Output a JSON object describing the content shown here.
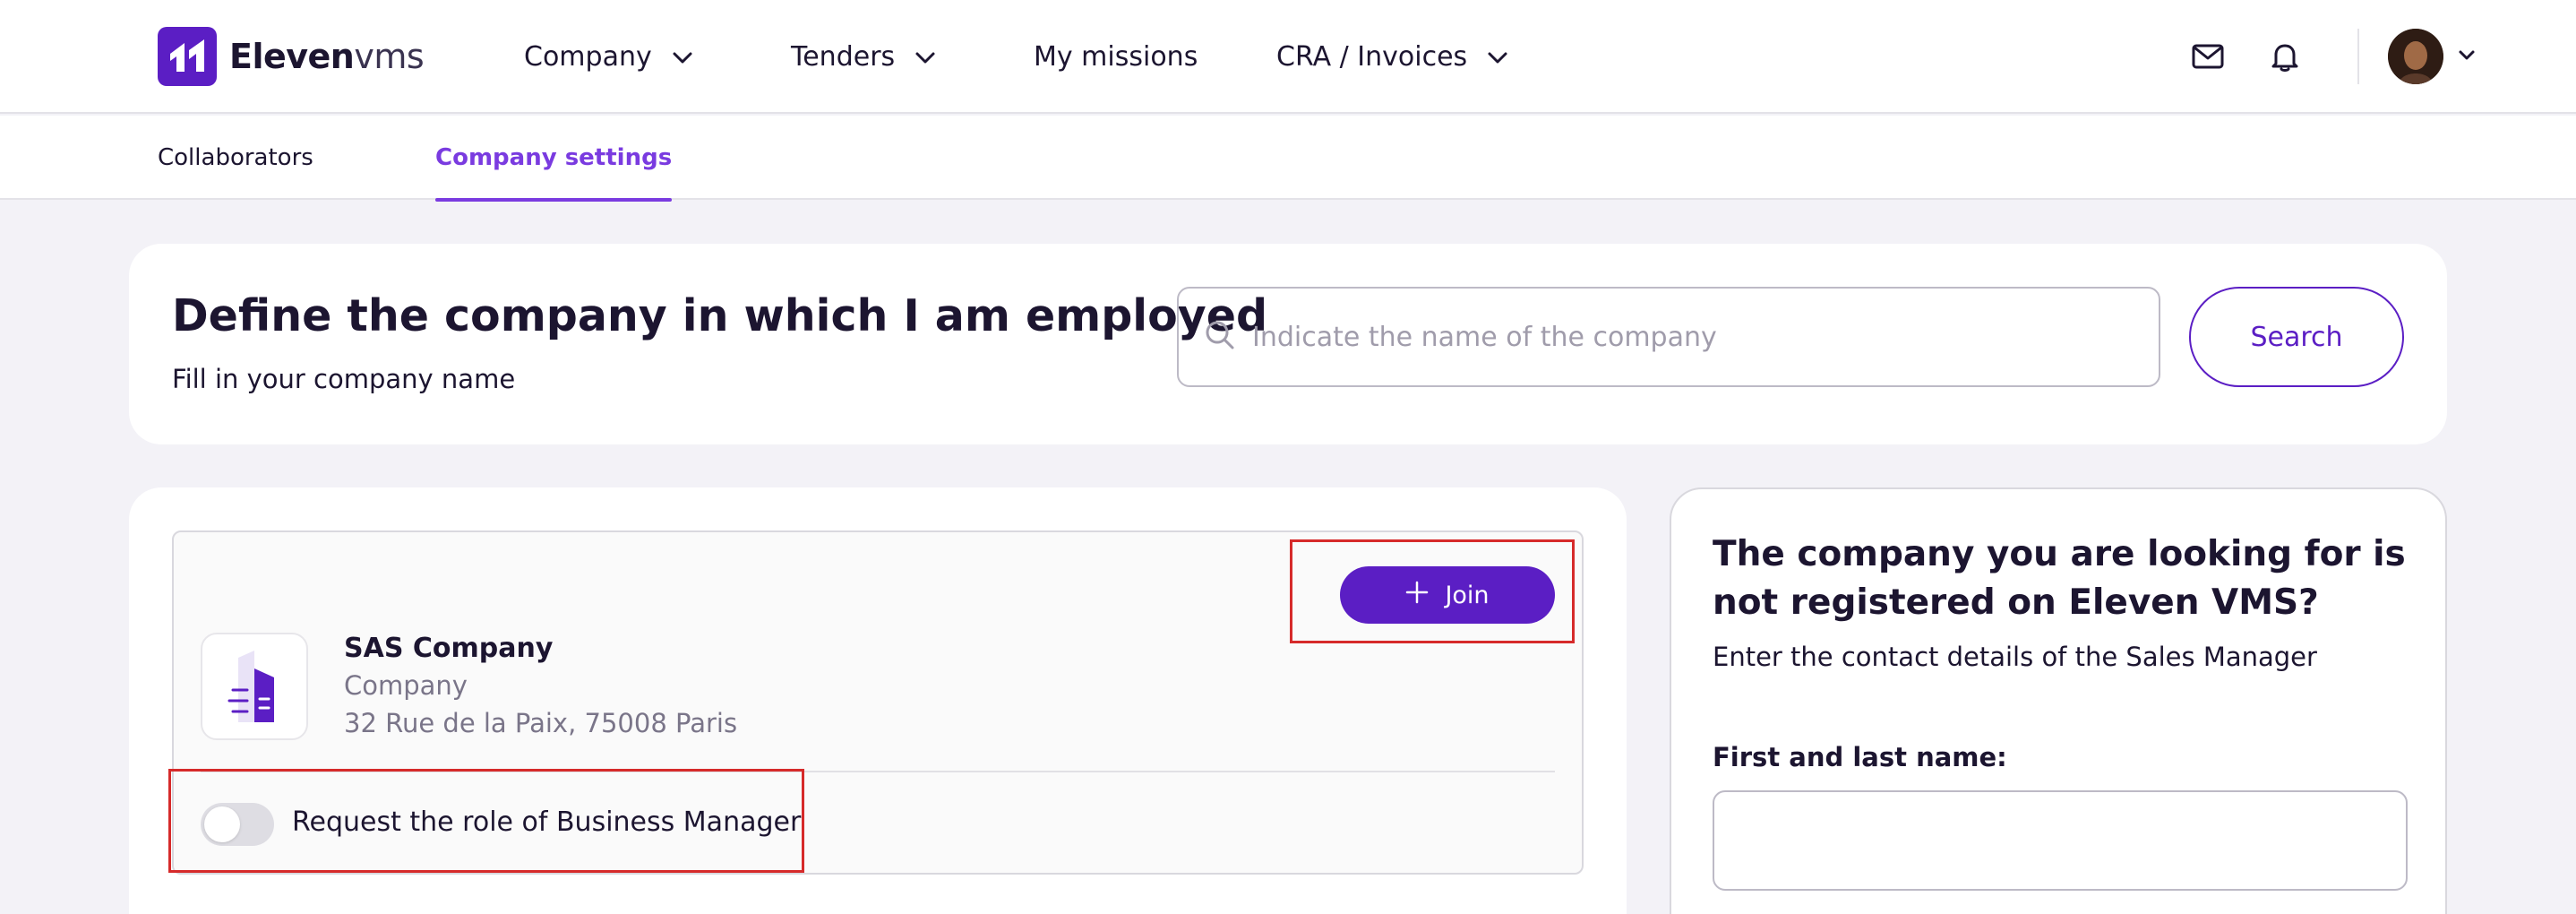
{
  "header": {
    "logo": {
      "bold": "Eleven",
      "light": "vms"
    },
    "nav": [
      {
        "label": "Company",
        "dropdown": true
      },
      {
        "label": "Tenders",
        "dropdown": true
      },
      {
        "label": "My missions",
        "dropdown": false
      },
      {
        "label": "CRA / Invoices",
        "dropdown": true
      }
    ],
    "icons": [
      "mail-icon",
      "bell-icon",
      "avatar",
      "chevron-down-icon"
    ]
  },
  "subnav": {
    "tabs": [
      {
        "label": "Collaborators",
        "active": false
      },
      {
        "label": "Company settings",
        "active": true
      }
    ]
  },
  "define_company": {
    "title": "Define the company in which I am employed",
    "subtitle": "Fill in your company name",
    "search_placeholder": "Indicate the name of the company",
    "search_value": "",
    "search_button": "Search"
  },
  "result": {
    "join_button": "Join",
    "company_name": "SAS Company",
    "company_type": "Company",
    "company_address": "32 Rue de la Paix, 75008 Paris",
    "toggle_label": "Request the role of Business Manager",
    "toggle_on": false
  },
  "not_registered": {
    "title": "The company you are looking for is not registered on Eleven VMS?",
    "subtitle": "Enter the contact details of the Sales Manager",
    "field_label": "First and last name:",
    "field_value": ""
  },
  "colors": {
    "brand": "#5b1ec4",
    "accent": "#7a3be0",
    "highlight": "#d62a2a",
    "background": "#f3f2f7"
  }
}
